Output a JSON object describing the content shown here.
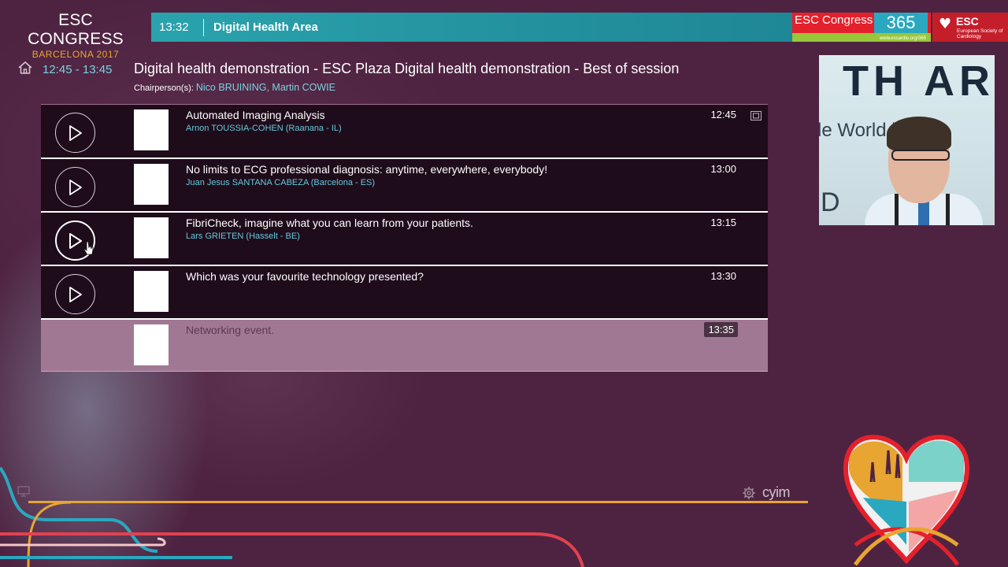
{
  "brand": {
    "congress_line1": "ESC CONGRESS",
    "congress_line2": "BARCELONA 2017",
    "esc365_label": "ESC Congress",
    "esc365_number": "365",
    "esc365_url": "www.escardio.org/365",
    "esc_name": "ESC",
    "esc_full": "European Society of Cardiology"
  },
  "topbar": {
    "clock": "13:32",
    "area": "Digital Health Area"
  },
  "session": {
    "time_range": "12:45 - 13:45",
    "title": "Digital health demonstration - ESC Plaza Digital health demonstration - Best of session",
    "chair_label": "Chairperson(s):",
    "chair_names": "Nico BRUINING, Martin COWIE"
  },
  "items": [
    {
      "title": "Automated Imaging Analysis",
      "speaker": "Arnon TOUSSIA-COHEN (Raanana - IL)",
      "time": "12:45"
    },
    {
      "title": "No limits to ECG professional diagnosis: anytime, everywhere, everybody!",
      "speaker": "Juan Jesus SANTANA CABEZA (Barcelona - ES)",
      "time": "13:00"
    },
    {
      "title": "FibriCheck, imagine what you can learn from your patients.",
      "speaker": "Lars GRIETEN (Hasselt - BE)",
      "time": "13:15"
    },
    {
      "title": "Which was your favourite technology presented?",
      "speaker": "",
      "time": "13:30"
    },
    {
      "title": "Networking event.",
      "speaker": "",
      "time": "13:35"
    }
  ],
  "video": {
    "bg_text_top": "TH AR",
    "bg_text_mid": "le World   l pro",
    "bg_text_letter": "D"
  },
  "footer": {
    "provider": "cyim"
  },
  "colors": {
    "background": "#4e2341",
    "accent_teal": "#2aa3ad",
    "accent_orange": "#e8a531",
    "speaker_blue": "#62c9dc"
  }
}
